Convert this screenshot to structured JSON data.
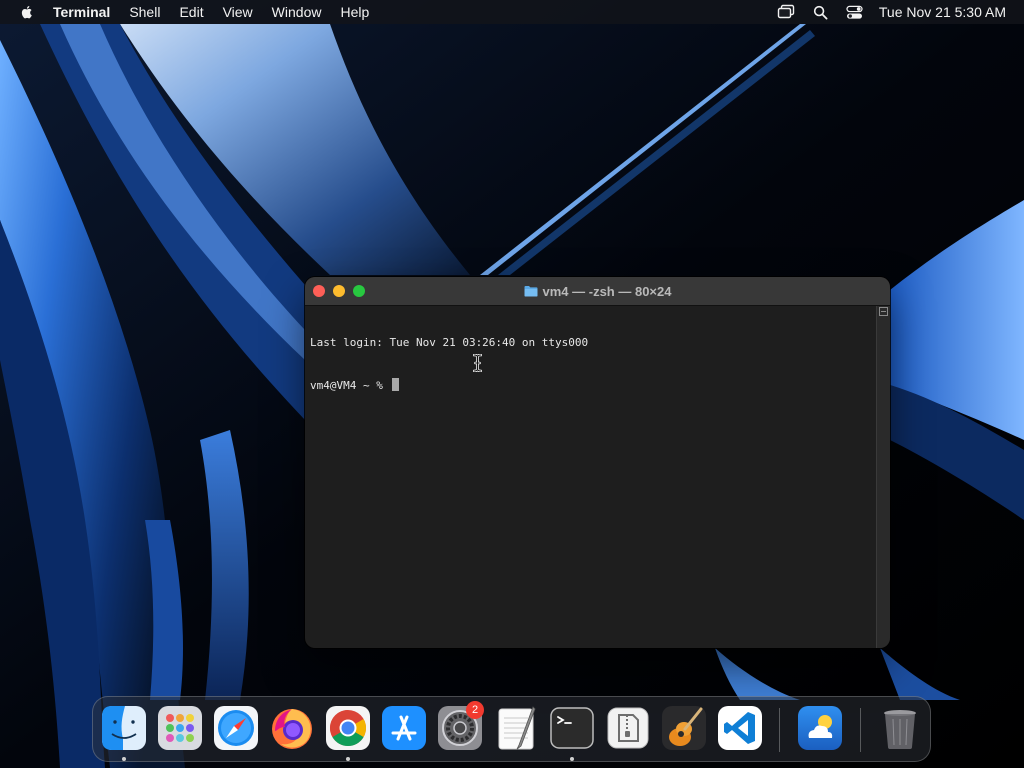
{
  "menubar": {
    "app_name": "Terminal",
    "menus": [
      "Shell",
      "Edit",
      "View",
      "Window",
      "Help"
    ],
    "clock": "Tue Nov 21  5:30 AM"
  },
  "terminal": {
    "title": "vm4 — -zsh — 80×24",
    "lines": [
      "Last login: Tue Nov 21 03:26:40 on ttys000",
      "vm4@VM4 ~ % "
    ]
  },
  "dock": {
    "apps": [
      {
        "name": "Finder",
        "icon": "finder-icon",
        "running": true
      },
      {
        "name": "Launchpad",
        "icon": "launchpad-icon",
        "running": false
      },
      {
        "name": "Safari",
        "icon": "safari-icon",
        "running": false
      },
      {
        "name": "Firefox",
        "icon": "firefox-icon",
        "running": false
      },
      {
        "name": "Google Chrome",
        "icon": "chrome-icon",
        "running": true
      },
      {
        "name": "App Store",
        "icon": "app-store-icon",
        "running": false
      },
      {
        "name": "System Settings",
        "icon": "system-settings-icon",
        "running": false,
        "badge": "2"
      },
      {
        "name": "TextEdit",
        "icon": "textedit-icon",
        "running": false
      },
      {
        "name": "Terminal",
        "icon": "terminal-icon",
        "running": true
      },
      {
        "name": "Archive Utility",
        "icon": "archive-utility-icon",
        "running": false
      },
      {
        "name": "GarageBand",
        "icon": "garageband-icon",
        "running": false
      },
      {
        "name": "Visual Studio Code",
        "icon": "vscode-icon",
        "running": false
      },
      {
        "name": "Weather",
        "icon": "weather-icon",
        "running": false
      },
      {
        "name": "Trash",
        "icon": "trash-icon",
        "running": false
      }
    ]
  },
  "colors": {
    "menubar_bg": "#12141a",
    "terminal_bg": "#1e1e1e",
    "close": "#fe5f57",
    "minimize": "#febc2e",
    "zoom": "#28c840",
    "badge": "#f23a2f"
  }
}
